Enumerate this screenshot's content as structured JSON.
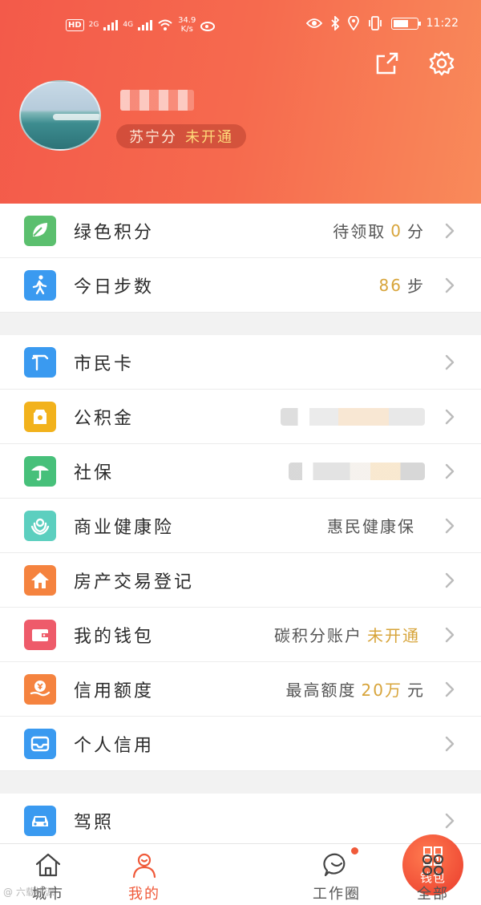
{
  "status_bar": {
    "hd": "HD",
    "net1": "2G",
    "net2": "4G",
    "speed_value": "34.9",
    "speed_unit": "K/s",
    "time": "11:22",
    "battery_level_percent": 70
  },
  "header": {
    "points_label": "苏宁分",
    "points_status": "未开通"
  },
  "groups": [
    [
      {
        "id": "green-points",
        "label": "绿色积分",
        "icon": "leaf-icon",
        "color": "#5bbf6e",
        "right_prefix": "待领取",
        "right_highlight": "0",
        "right_suffix": "分"
      },
      {
        "id": "steps",
        "label": "今日步数",
        "icon": "walking-icon",
        "color": "#3a9af0",
        "right_prefix": "",
        "right_highlight": "86",
        "right_suffix": "步"
      }
    ],
    [
      {
        "id": "citizen-card",
        "label": "市民卡",
        "icon": "card-icon",
        "color": "#3a9af0",
        "right_prefix": "",
        "right_highlight": "",
        "right_suffix": ""
      },
      {
        "id": "housing-fund",
        "label": "公积金",
        "icon": "fund-icon",
        "color": "#f2b21c",
        "right_prefix": "",
        "right_highlight": "",
        "right_suffix": "",
        "blurred": "blur1"
      },
      {
        "id": "social-security",
        "label": "社保",
        "icon": "umbrella-icon",
        "color": "#47c07a",
        "right_prefix": "",
        "right_highlight": "",
        "right_suffix": "",
        "blurred": "blur2"
      },
      {
        "id": "health-insurance",
        "label": "商业健康险",
        "icon": "shield-icon",
        "color": "#5ccfbf",
        "right_prefix": "惠民健康保",
        "right_highlight": "",
        "right_suffix": ""
      },
      {
        "id": "property",
        "label": "房产交易登记",
        "icon": "house-icon",
        "color": "#f5833f",
        "right_prefix": "",
        "right_highlight": "",
        "right_suffix": ""
      },
      {
        "id": "wallet",
        "label": "我的钱包",
        "icon": "wallet-icon",
        "color": "#ee5b6a",
        "right_prefix": "碳积分账户",
        "right_highlight": "未开通",
        "right_suffix": ""
      },
      {
        "id": "credit-limit",
        "label": "信用额度",
        "icon": "yen-icon",
        "color": "#f5833f",
        "right_prefix": "最高额度",
        "right_highlight": "20万",
        "right_suffix": "元"
      },
      {
        "id": "personal-credit",
        "label": "个人信用",
        "icon": "inbox-icon",
        "color": "#3a9af0",
        "right_prefix": "",
        "right_highlight": "",
        "right_suffix": ""
      }
    ],
    [
      {
        "id": "driver-license",
        "label": "驾照",
        "icon": "car-icon",
        "color": "#3a9af0",
        "right_prefix": "",
        "right_highlight": "",
        "right_suffix": ""
      }
    ]
  ],
  "tabs": [
    {
      "id": "city",
      "label": "城市",
      "icon": "home-icon"
    },
    {
      "id": "mine",
      "label": "我的",
      "icon": "person-icon",
      "active": true
    },
    {
      "id": "wallet",
      "label": "钱包",
      "icon": "qrcode-icon"
    },
    {
      "id": "work-circle",
      "label": "工作圈",
      "icon": "chat-icon"
    },
    {
      "id": "all",
      "label": "全部",
      "icon": "grid-icon"
    }
  ],
  "watermark": "@ 六载桃源"
}
